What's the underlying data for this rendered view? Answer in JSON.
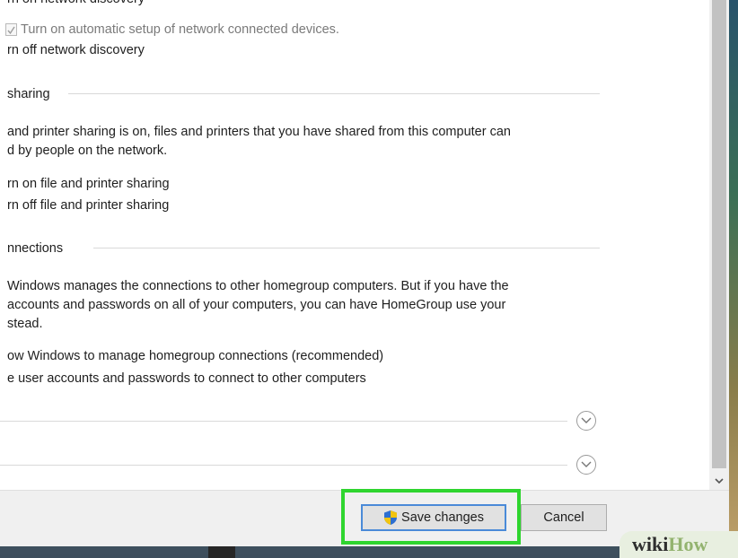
{
  "content": {
    "cut_top_line": "rn on network discovery",
    "auto_setup_checkbox_label": "Turn on automatic setup of network connected devices.",
    "network_discovery_off": "rn off network discovery",
    "file_sharing": {
      "section_title": "sharing",
      "description_line1": "and printer sharing is on, files and printers that you have shared from this computer can",
      "description_line2": "d by people on the network.",
      "option_on": "rn on file and printer sharing",
      "option_off": "rn off file and printer sharing"
    },
    "homegroup": {
      "section_title": "nnections",
      "description_line1": "Windows manages the connections to other homegroup computers. But if you have the",
      "description_line2": "accounts and passwords on all of your computers, you can have HomeGroup use your",
      "description_line3": "stead.",
      "option_windows": "ow Windows to manage homegroup connections (recommended)",
      "option_user": "e user accounts and passwords to connect to other computers"
    }
  },
  "footer": {
    "save_label": "Save changes",
    "cancel_label": "Cancel"
  },
  "watermark": {
    "wiki": "wiki",
    "how": "How"
  },
  "colors": {
    "highlight": "#2fd52f",
    "shield_blue": "#2d6fd0",
    "shield_yellow": "#f1c40f"
  },
  "icons": [
    "checkbox-icon",
    "chevron-down-icon",
    "uac-shield-icon",
    "scroll-down-arrow-icon"
  ]
}
